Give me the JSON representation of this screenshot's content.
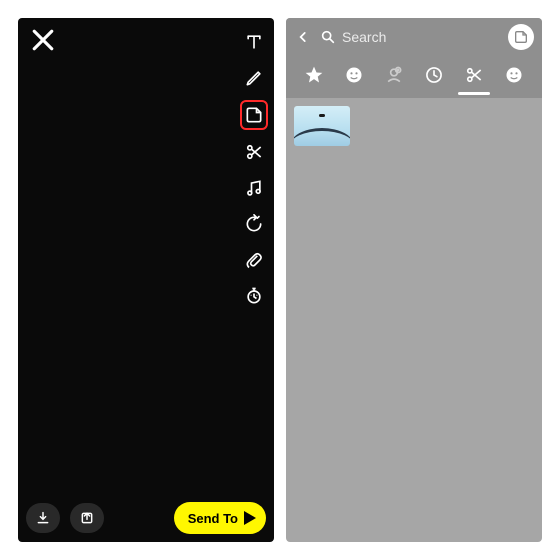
{
  "editor": {
    "tools": {
      "text": "text-icon",
      "pencil": "pencil-icon",
      "sticker": "sticker-icon",
      "scissors": "scissors-icon",
      "music": "music-icon",
      "rewind": "rewind-icon",
      "attach": "attachment-icon",
      "timer": "timer-icon"
    },
    "bottom": {
      "save_icon": "download-icon",
      "story_icon": "add-to-story-icon",
      "send_label": "Send To"
    }
  },
  "picker": {
    "search_placeholder": "Search",
    "tabs": {
      "star": "star-tab",
      "emoji": "emoji-tab",
      "bitmoji": "bitmoji-tab",
      "recent": "recent-tab",
      "scissors": "scissors-tab",
      "smiley": "smiley-tab"
    },
    "stickers": [
      {
        "name": "custom-sticker-1"
      }
    ]
  },
  "colors": {
    "accent": "#fff700",
    "highlight": "#ff2a2a"
  }
}
